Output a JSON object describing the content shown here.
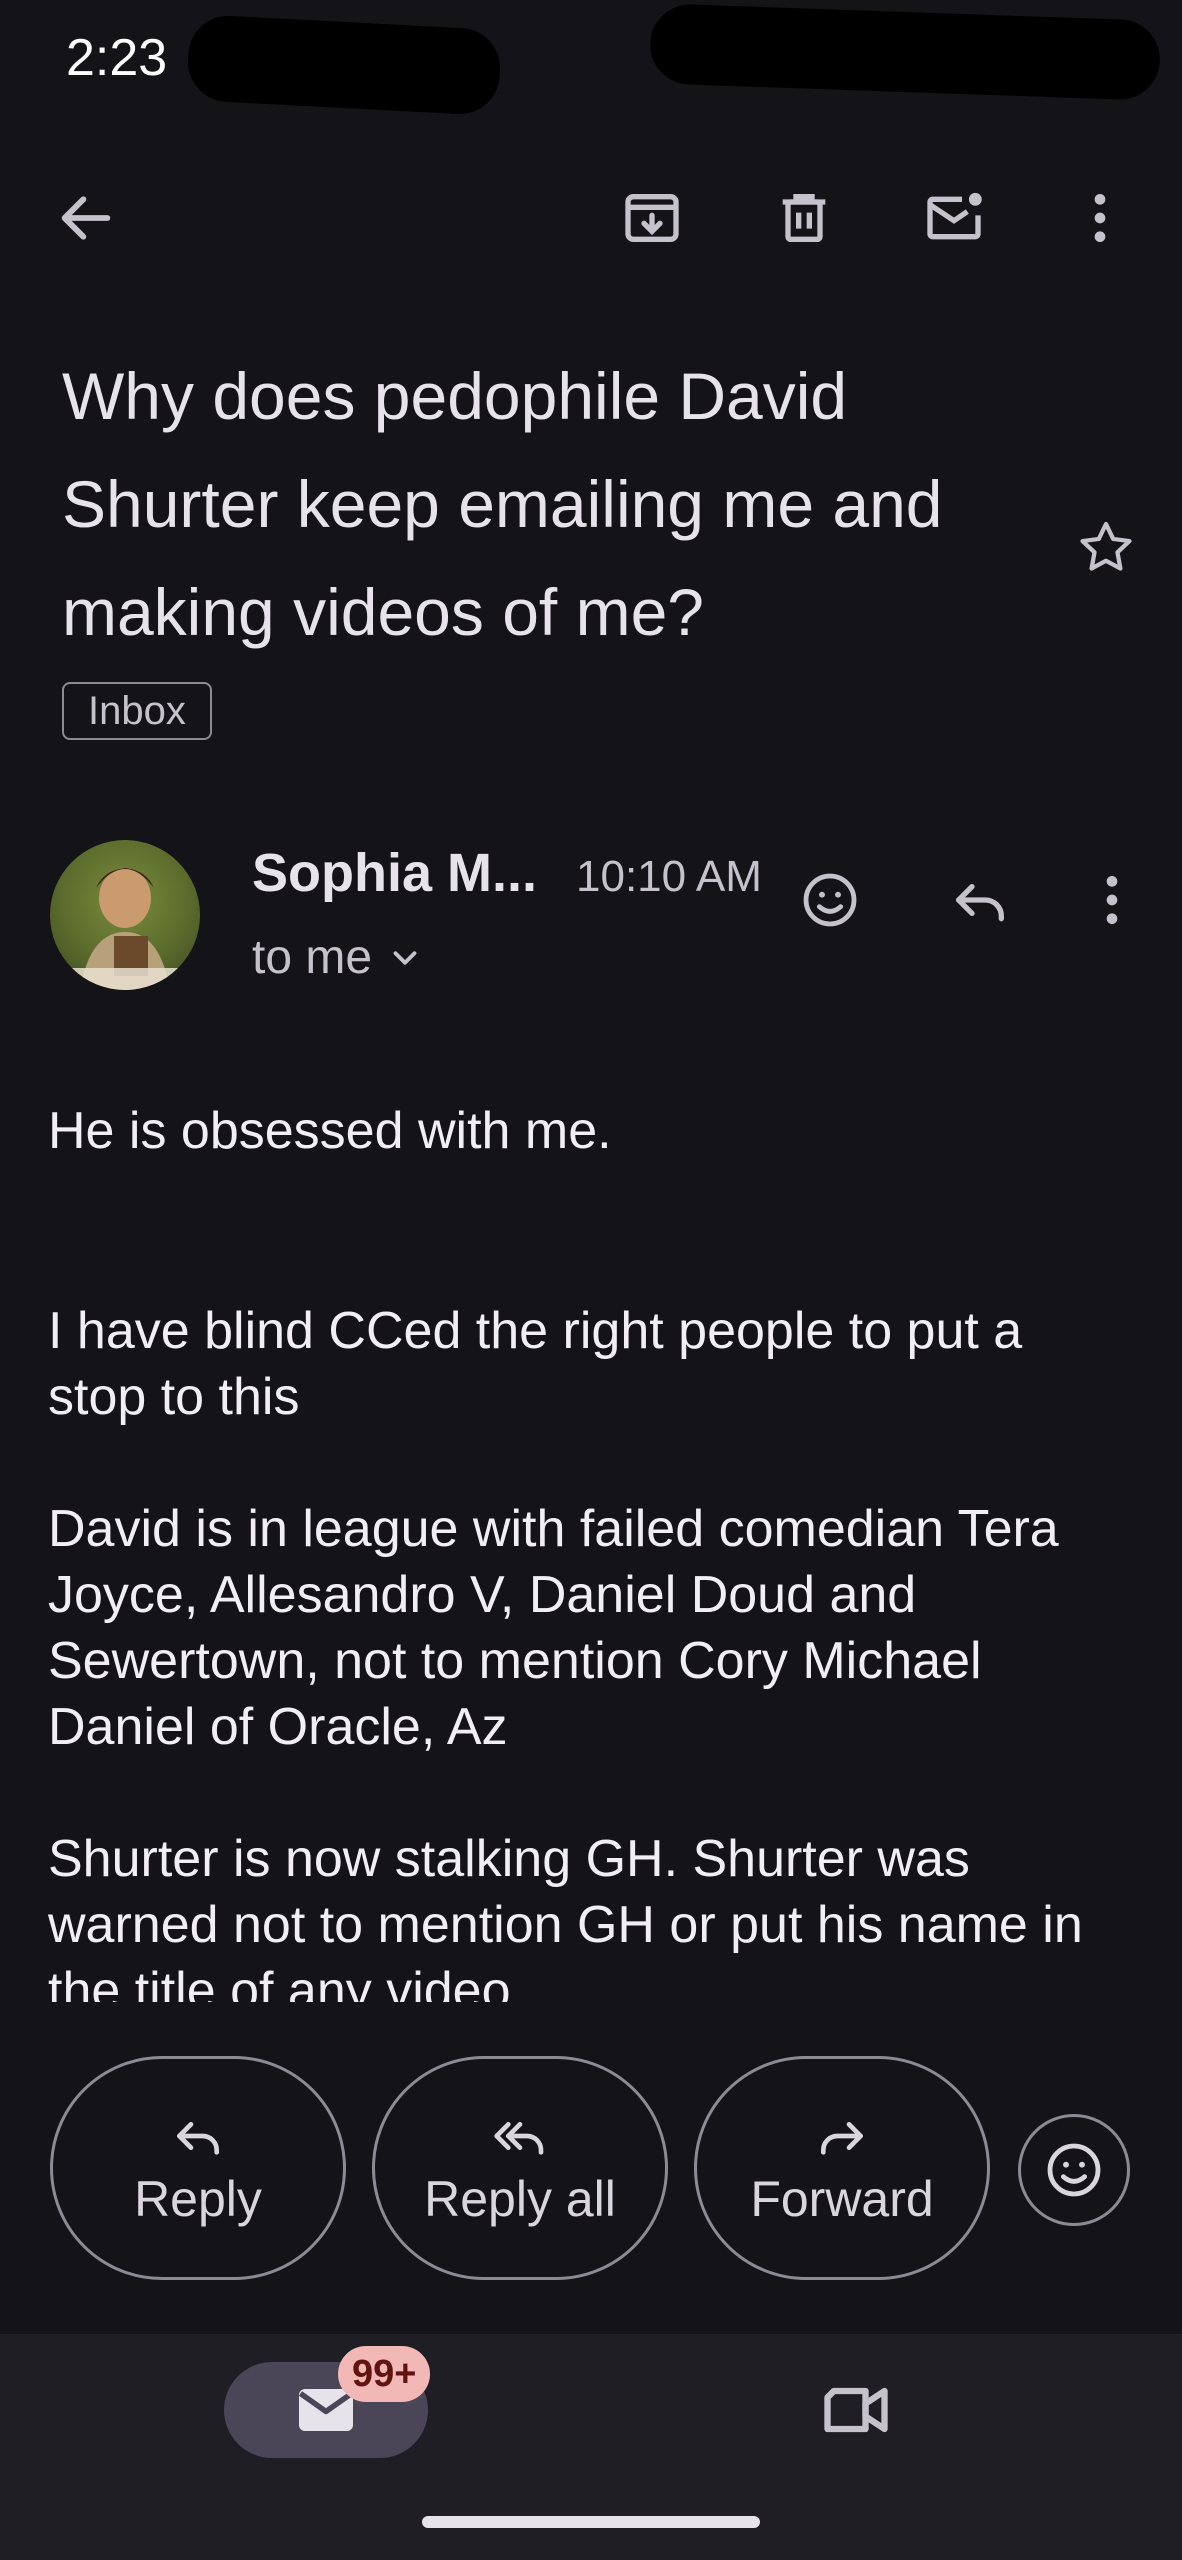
{
  "status_bar": {
    "time": "2:23"
  },
  "toolbar": {
    "back_icon": "arrow-left-icon",
    "archive_icon": "archive-icon",
    "delete_icon": "trash-icon",
    "mark_unread_icon": "mail-unread-icon",
    "more_icon": "more-vert-icon"
  },
  "email": {
    "subject": "Why does pedophile David Shurter keep emailing me and making videos of me?",
    "label": "Inbox",
    "sender_name": "Sophia M...",
    "time": "10:10 AM",
    "recipient": "to me",
    "body": [
      "He is obsessed with me.",
      "I have blind CCed the right people to put a stop to this",
      "David is in league with failed comedian Tera Joyce, Allesandro V, Daniel Doud and Sewertown, not to mention Cory Michael Daniel of Oracle, Az",
      "Shurter is now stalking GH. Shurter was warned not to mention GH or put his name in the title of any video"
    ]
  },
  "actions": {
    "reply": "Reply",
    "reply_all": "Reply all",
    "forward": "Forward"
  },
  "bottom_nav": {
    "mail_badge": "99+",
    "mail_icon": "mail-icon",
    "meet_icon": "video-camera-icon"
  },
  "colors": {
    "background": "#141318",
    "text": "#e6e3ea",
    "outline": "#8e8a94",
    "nav_active": "#4a4658",
    "badge_bg": "#f2b8b5",
    "badge_text": "#601410"
  }
}
